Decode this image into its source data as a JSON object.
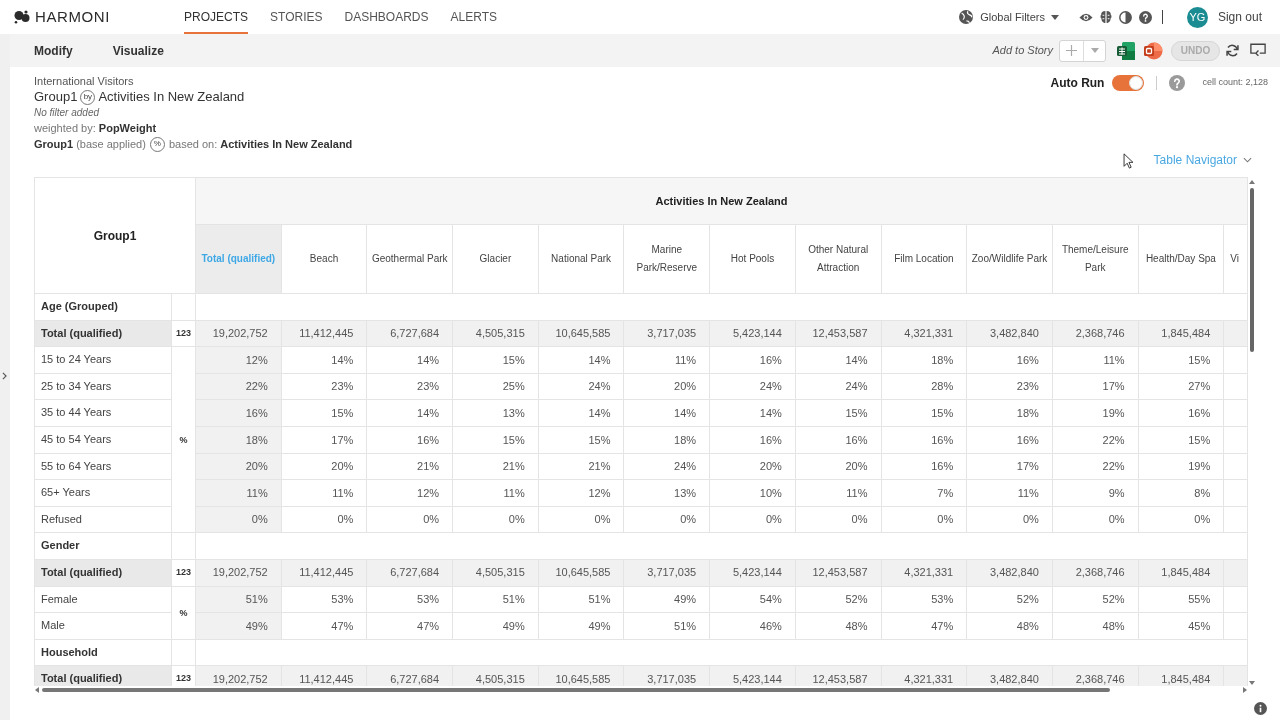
{
  "nav": {
    "logo": "HARMONI",
    "tabs": [
      {
        "label": "PROJECTS",
        "selected": true
      },
      {
        "label": "STORIES",
        "selected": false
      },
      {
        "label": "DASHBOARDS",
        "selected": false
      },
      {
        "label": "ALERTS",
        "selected": false
      }
    ],
    "global_filters": "Global Filters",
    "user_initials": "YG",
    "sign_out": "Sign out"
  },
  "toolbar": {
    "menu": [
      "Modify",
      "Visualize"
    ],
    "add_to_story": "Add to Story",
    "undo": {
      "label": "UNDO",
      "disabled": true
    }
  },
  "report": {
    "dataset": "International Visitors",
    "title": {
      "rows": "Group1",
      "operator": "by",
      "columns": "Activities In New Zealand"
    },
    "filter_note": "No filter added",
    "weighting": "weighted by: **PopWeight**",
    "base": {
      "target": "**Group1** (base applied)",
      "operator": "%",
      "source": "based on: **Activities In New Zealand**"
    }
  },
  "auto_run": {
    "label": "Auto Run",
    "on": true
  },
  "cell_count": "cell count: 2,128",
  "table_navigator": "Table Navigator",
  "table": {
    "corner": "Group1",
    "banner": "Activities In New Zealand",
    "columns": [
      {
        "label": "Total (qualified)",
        "kind": "total"
      },
      {
        "label": "Beach",
        "kind": "category"
      },
      {
        "label": "Geothermal Park",
        "kind": "category"
      },
      {
        "label": "Glacier",
        "kind": "category"
      },
      {
        "label": "National Park",
        "kind": "category"
      },
      {
        "label": "Marine Park/Reserve",
        "kind": "category"
      },
      {
        "label": "Hot Pools",
        "kind": "category"
      },
      {
        "label": "Other Natural Attraction",
        "kind": "category"
      },
      {
        "label": "Film Location",
        "kind": "category"
      },
      {
        "label": "Zoo/Wildlife Park",
        "kind": "category"
      },
      {
        "label": "Theme/Leisure Park",
        "kind": "category"
      },
      {
        "label": "Health/Day Spa",
        "kind": "category"
      },
      {
        "label": "Vi",
        "kind": "category"
      }
    ],
    "sections": [
      {
        "title": "Age (Grouped)",
        "total": {
          "label": "Total (qualified)",
          "unit": "123",
          "values": [
            "19,202,752",
            "11,412,445",
            "6,727,684",
            "4,505,315",
            "10,645,585",
            "3,717,035",
            "5,423,144",
            "12,453,587",
            "4,321,331",
            "3,482,840",
            "2,368,746",
            "1,845,484"
          ]
        },
        "breakdown": {
          "unit": "%",
          "rows": [
            {
              "label": "15 to 24 Years",
              "values": [
                "12%",
                "14%",
                "14%",
                "15%",
                "14%",
                "11%",
                "16%",
                "14%",
                "18%",
                "16%",
                "11%",
                "15%"
              ]
            },
            {
              "label": "25 to 34 Years",
              "values": [
                "22%",
                "23%",
                "23%",
                "25%",
                "24%",
                "20%",
                "24%",
                "24%",
                "28%",
                "23%",
                "17%",
                "27%"
              ]
            },
            {
              "label": "35 to 44 Years",
              "values": [
                "16%",
                "15%",
                "14%",
                "13%",
                "14%",
                "14%",
                "14%",
                "15%",
                "15%",
                "18%",
                "19%",
                "16%"
              ]
            },
            {
              "label": "45 to 54 Years",
              "values": [
                "18%",
                "17%",
                "16%",
                "15%",
                "15%",
                "18%",
                "16%",
                "16%",
                "16%",
                "16%",
                "22%",
                "15%"
              ]
            },
            {
              "label": "55 to 64 Years",
              "values": [
                "20%",
                "20%",
                "21%",
                "21%",
                "21%",
                "24%",
                "20%",
                "20%",
                "16%",
                "17%",
                "22%",
                "19%"
              ]
            },
            {
              "label": "65+ Years",
              "values": [
                "11%",
                "11%",
                "12%",
                "11%",
                "12%",
                "13%",
                "10%",
                "11%",
                "7%",
                "11%",
                "9%",
                "8%"
              ]
            },
            {
              "label": "Refused",
              "values": [
                "0%",
                "0%",
                "0%",
                "0%",
                "0%",
                "0%",
                "0%",
                "0%",
                "0%",
                "0%",
                "0%",
                "0%"
              ]
            }
          ]
        }
      },
      {
        "title": "Gender",
        "total": {
          "label": "Total (qualified)",
          "unit": "123",
          "values": [
            "19,202,752",
            "11,412,445",
            "6,727,684",
            "4,505,315",
            "10,645,585",
            "3,717,035",
            "5,423,144",
            "12,453,587",
            "4,321,331",
            "3,482,840",
            "2,368,746",
            "1,845,484"
          ]
        },
        "breakdown": {
          "unit": "%",
          "rows": [
            {
              "label": "Female",
              "values": [
                "51%",
                "53%",
                "53%",
                "51%",
                "51%",
                "49%",
                "54%",
                "52%",
                "53%",
                "52%",
                "52%",
                "55%"
              ]
            },
            {
              "label": "Male",
              "values": [
                "49%",
                "47%",
                "47%",
                "49%",
                "49%",
                "51%",
                "46%",
                "48%",
                "47%",
                "48%",
                "48%",
                "45%"
              ]
            }
          ]
        }
      },
      {
        "title": "Household",
        "total": {
          "label": "Total (qualified)",
          "unit": "123",
          "values": [
            "19,202,752",
            "11,412,445",
            "6,727,684",
            "4,505,315",
            "10,645,585",
            "3,717,035",
            "5,423,144",
            "12,453,587",
            "4,321,331",
            "3,482,840",
            "2,368,746",
            "1,845,484"
          ]
        }
      }
    ]
  }
}
